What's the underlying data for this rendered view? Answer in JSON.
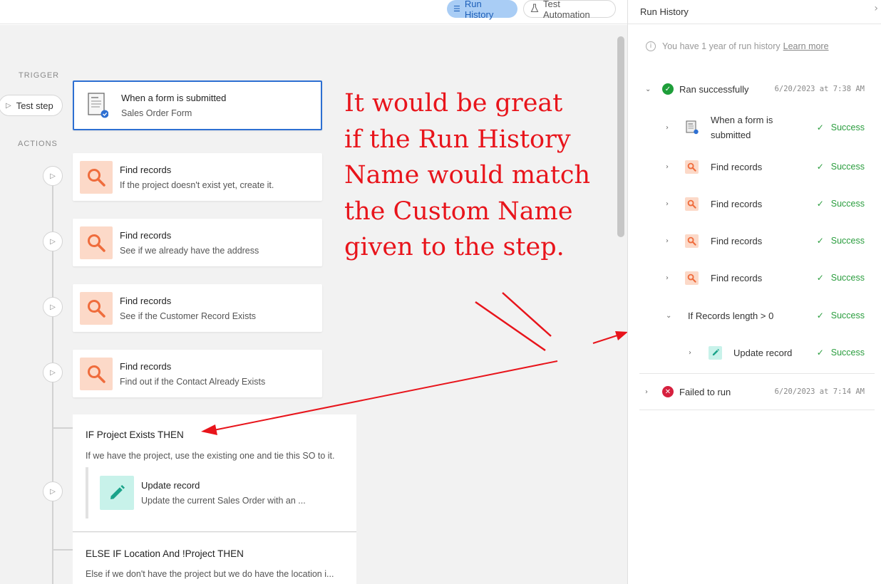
{
  "topbar": {
    "run_history_label": "Run History",
    "test_automation_label": "Test Automation"
  },
  "canvas": {
    "trigger_label": "TRIGGER",
    "actions_label": "ACTIONS",
    "test_step_label": "Test step",
    "trigger_card": {
      "title": "When a form is submitted",
      "subtitle": "Sales Order Form",
      "icon": "form-doc-icon"
    },
    "action_cards": [
      {
        "title": "Find records",
        "subtitle": "If the project doesn't exist yet, create it.",
        "icon": "search-icon"
      },
      {
        "title": "Find records",
        "subtitle": "See if we already have the address",
        "icon": "search-icon"
      },
      {
        "title": "Find records",
        "subtitle": "See if the Customer Record Exists",
        "icon": "search-icon"
      },
      {
        "title": "Find records",
        "subtitle": "Find out if the Contact Already Exists",
        "icon": "search-icon"
      }
    ],
    "if_block": {
      "title": "IF Project Exists THEN",
      "description": "If we have the project, use the existing one and tie this SO to it.",
      "nested": {
        "title": "Update record",
        "subtitle": "Update the current Sales Order with an ...",
        "icon": "pencil-icon"
      }
    },
    "else_block": {
      "title": "ELSE IF Location And !Project THEN",
      "description": "Else if we don't have the project but we do have the location i..."
    },
    "annotation_lines": [
      "It would be great",
      "if the Run History",
      "Name would match",
      "the Custom Name",
      "given to the step."
    ],
    "annotation_color": "#e8141b"
  },
  "panel": {
    "title": "Run History",
    "info_text": "You have 1 year of run history",
    "learn_more": "Learn more",
    "runs": [
      {
        "status": "Ran successfully",
        "timestamp": "6/20/2023 at 7:38 AM",
        "expanded": true,
        "status_color": "#1e9e3a",
        "steps": [
          {
            "label": "When a form is submitted",
            "status": "Success",
            "icon": "form-doc-icon"
          },
          {
            "label": "Find records",
            "status": "Success",
            "icon": "search-icon"
          },
          {
            "label": "Find records",
            "status": "Success",
            "icon": "search-icon"
          },
          {
            "label": "Find records",
            "status": "Success",
            "icon": "search-icon"
          },
          {
            "label": "Find records",
            "status": "Success",
            "icon": "search-icon"
          },
          {
            "label": "If Records length > 0",
            "status": "Success",
            "icon": "none"
          },
          {
            "label": "Update record",
            "status": "Success",
            "icon": "pencil-icon"
          }
        ]
      },
      {
        "status": "Failed to run",
        "timestamp": "6/20/2023 at 7:14 AM",
        "expanded": false,
        "status_color": "#d6203e"
      }
    ]
  },
  "colors": {
    "accent": "#2d6fd2",
    "success": "#2a9d3e",
    "search_icon": "#ef6c3c",
    "edit_icon": "#1aa38a"
  }
}
